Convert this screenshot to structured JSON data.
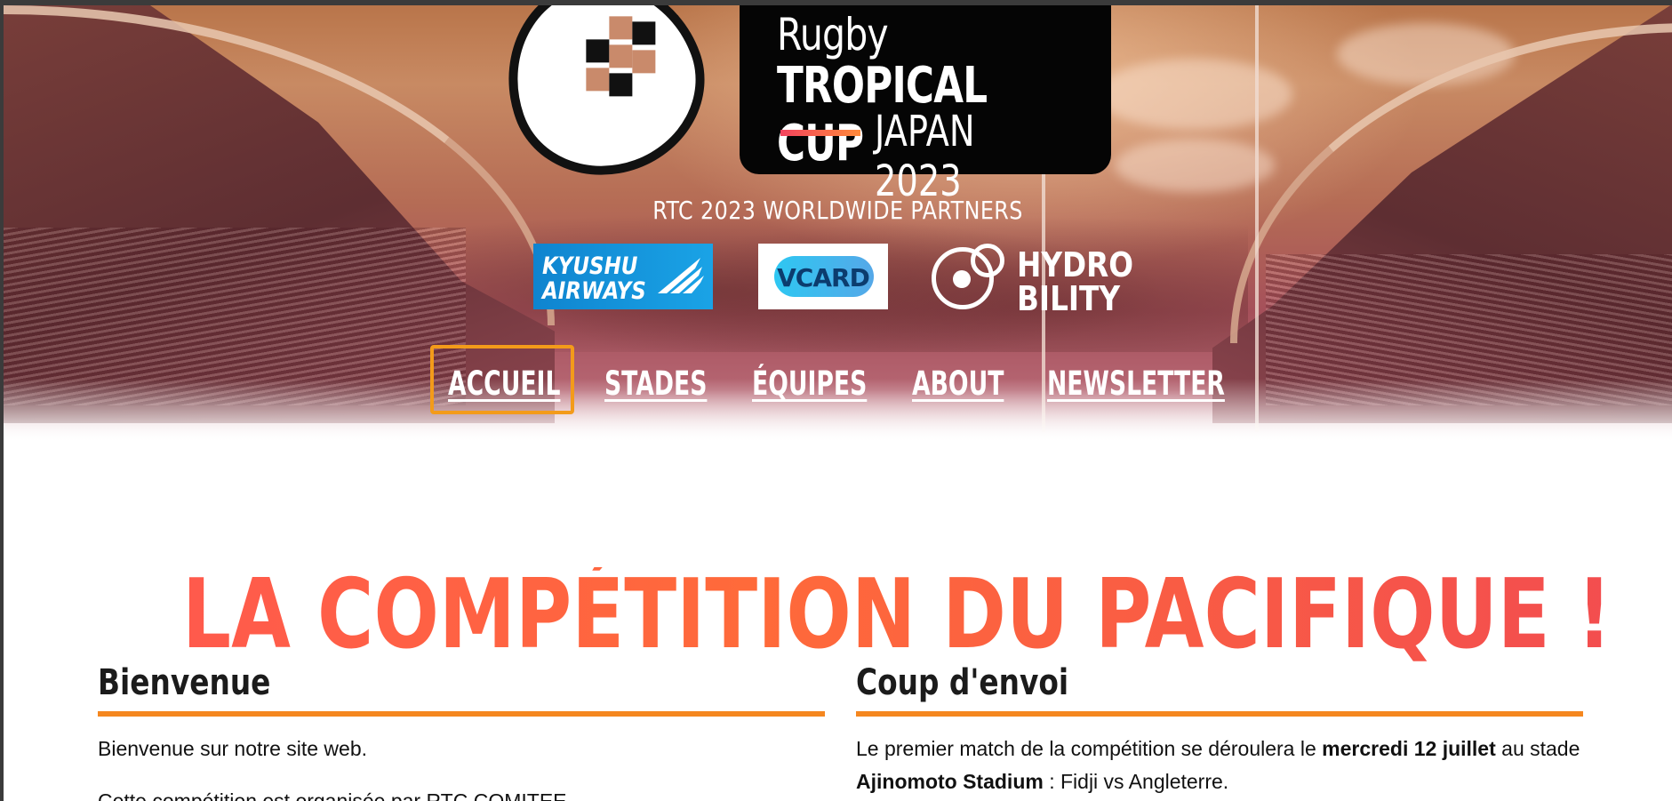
{
  "hero": {
    "title_line1": "Rugby",
    "title_line2": "TROPICAL CUP",
    "title_line3": "JAPAN 2023",
    "partners_title": "RTC 2023 WORLDWIDE PARTNERS",
    "partners": {
      "kyushu_line1": "KYUSHU",
      "kyushu_line2": "AIRWAYS",
      "vcard": "VCARD",
      "hydro_line1": "HYDRO",
      "hydro_line2": "BILITY"
    },
    "colors": {
      "logo_bar_start": "#f3435e",
      "logo_bar_end": "#ff8a3a",
      "ball_mark": "#c98a6b"
    }
  },
  "nav": {
    "items": [
      {
        "label": "ACCUEIL"
      },
      {
        "label": "STADES"
      },
      {
        "label": "ÉQUIPES"
      },
      {
        "label": "ABOUT"
      },
      {
        "label": "NEWSLETTER"
      }
    ],
    "focused": "ACCUEIL",
    "focus_color": "#f39b1a"
  },
  "main": {
    "headline_strong": "LA",
    "headline_rest": "COMPÉTITION DU PACIFIQUE !",
    "accent_color": "#f5871f",
    "welcome": {
      "title": "Bienvenue",
      "p1": "Bienvenue sur notre site web.",
      "p2": "Cette compétition est organisée par RTC COMITEE."
    },
    "kickoff": {
      "title": "Coup d'envoi",
      "text_1": "Le premier match de la compétition se déroulera le ",
      "date": "mercredi 12 juillet",
      "text_2": " au stade ",
      "stadium": "Ajinomoto Stadium",
      "text_3": " : Fidji vs Angleterre."
    }
  }
}
